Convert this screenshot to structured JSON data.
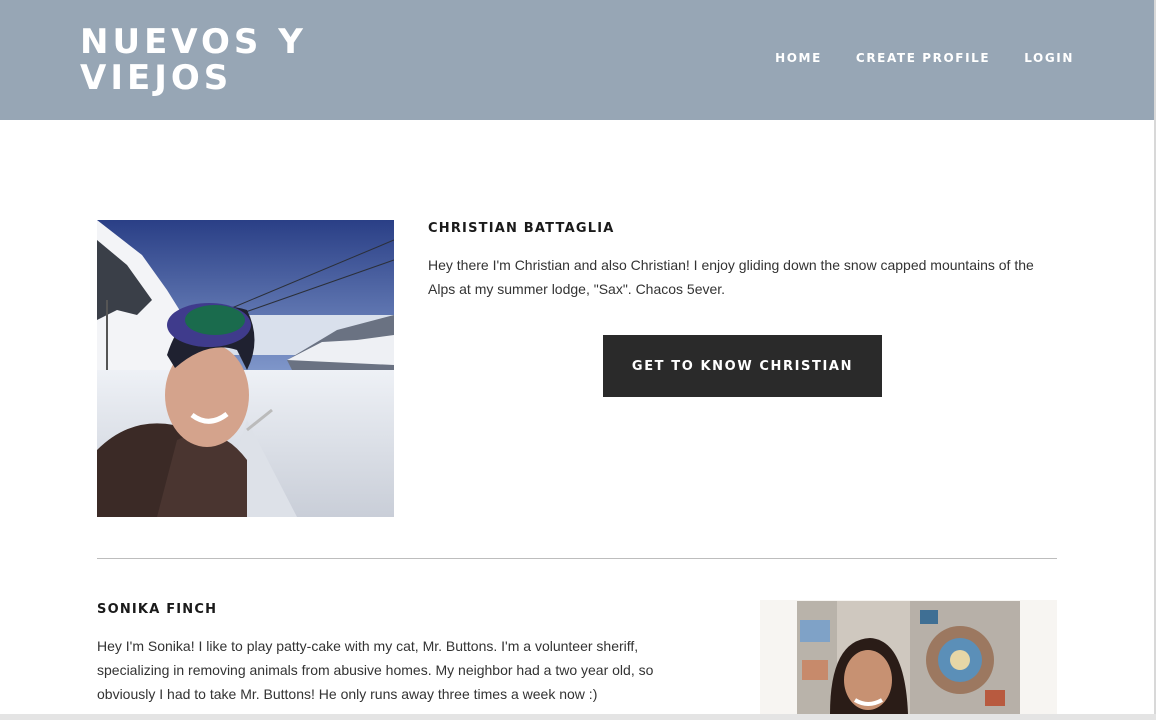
{
  "site": {
    "logo": "NUEVOS Y VIEJOS"
  },
  "nav": {
    "items": [
      "HOME",
      "CREATE PROFILE",
      "LOGIN"
    ]
  },
  "profiles": [
    {
      "name": "CHRISTIAN BATTAGLIA",
      "bio": "Hey there I'm Christian and also Christian! I enjoy gliding down the snow capped mountains of the Alps at my summer lodge, \"Sax\". Chacos 5ever.",
      "cta_label": "GET TO KNOW CHRISTIAN"
    },
    {
      "name": "SONIKA FINCH",
      "bio": "Hey I'm Sonika! I like to play patty-cake with my cat, Mr. Buttons. I'm a volunteer sheriff, specializing in removing animals from abusive homes. My neighbor had a two year old, so obviously I had to take Mr. Buttons! He only runs away three times a week now :)"
    }
  ],
  "colors": {
    "header_bg": "#97a6b5",
    "button_bg": "#2a2a2a",
    "text": "#333333"
  }
}
